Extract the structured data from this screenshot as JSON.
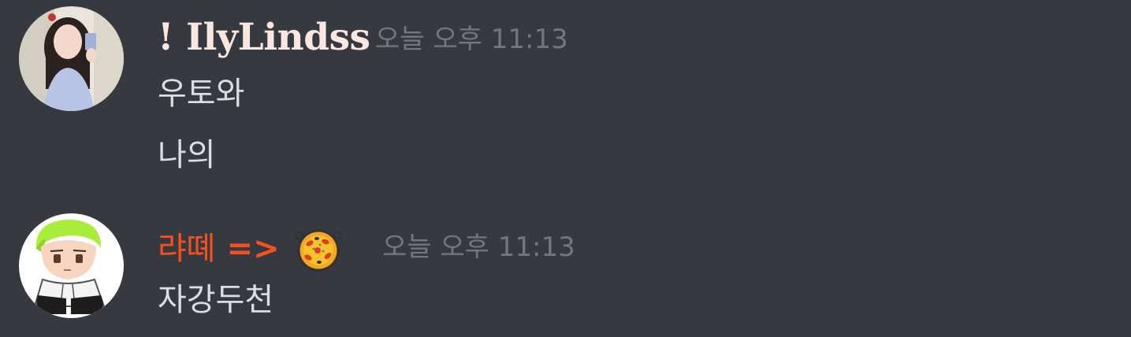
{
  "messages": [
    {
      "author": "! IlyLindss",
      "timestamp": "오늘 오후 11:13",
      "avatar": "avatar-photo",
      "lines": [
        "우토와",
        "나의"
      ]
    },
    {
      "author": "랴뗴",
      "author_suffix": "=>",
      "author_emoji": "paella-icon",
      "timestamp": "오늘 오후 11:13",
      "avatar": "avatar-cartoon",
      "lines": [
        "자강두천"
      ]
    }
  ],
  "colors": {
    "background": "#36393f",
    "author1": "#fbe7df",
    "author2": "#f4511e",
    "timestamp": "#72767d",
    "text": "#dcddde"
  }
}
